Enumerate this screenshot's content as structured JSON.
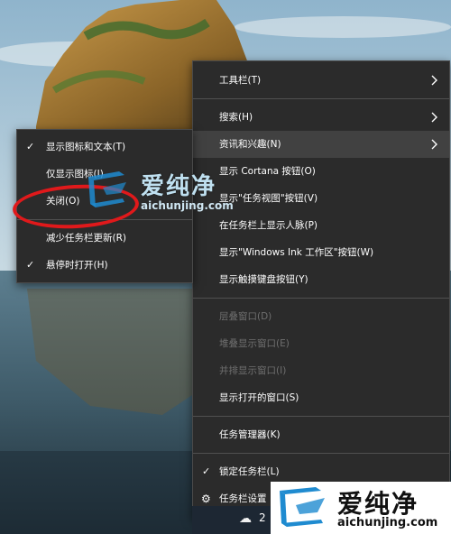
{
  "main_menu": {
    "items": [
      {
        "label": "工具栏(T)",
        "submenu": true
      },
      {
        "label": "搜索(H)",
        "submenu": true
      },
      {
        "label": "资讯和兴趣(N)",
        "submenu": true,
        "highlighted": true
      },
      {
        "label": "显示 Cortana 按钮(O)"
      },
      {
        "label": "显示\"任务视图\"按钮(V)"
      },
      {
        "label": "在任务栏上显示人脉(P)"
      },
      {
        "label": "显示\"Windows Ink 工作区\"按钮(W)"
      },
      {
        "label": "显示触摸键盘按钮(Y)"
      },
      {
        "label": "层叠窗口(D)",
        "disabled": true
      },
      {
        "label": "堆叠显示窗口(E)",
        "disabled": true
      },
      {
        "label": "并排显示窗口(I)",
        "disabled": true
      },
      {
        "label": "显示打开的窗口(S)"
      },
      {
        "label": "任务管理器(K)"
      },
      {
        "label": "锁定任务栏(L)",
        "checked": true
      },
      {
        "label": "任务栏设置",
        "icon": "gear-icon"
      }
    ]
  },
  "news_submenu": {
    "items": [
      {
        "label": "显示图标和文本(T)",
        "checked": true
      },
      {
        "label": "仅显示图标(I)"
      },
      {
        "label": "关闭(O)",
        "annotated": true
      },
      {
        "label": "减少任务栏更新(R)"
      },
      {
        "label": "悬停时打开(H)",
        "checked": true
      }
    ]
  },
  "watermark": {
    "title": "爱纯净",
    "url": "aichunjing.com"
  },
  "taskbar": {
    "weather_icon": "cloud-icon",
    "temperature": "2"
  },
  "colors": {
    "menu_bg": "#2b2b2b",
    "annotation_red": "#e0191b",
    "watermark_blue": "#1f8bd0"
  }
}
